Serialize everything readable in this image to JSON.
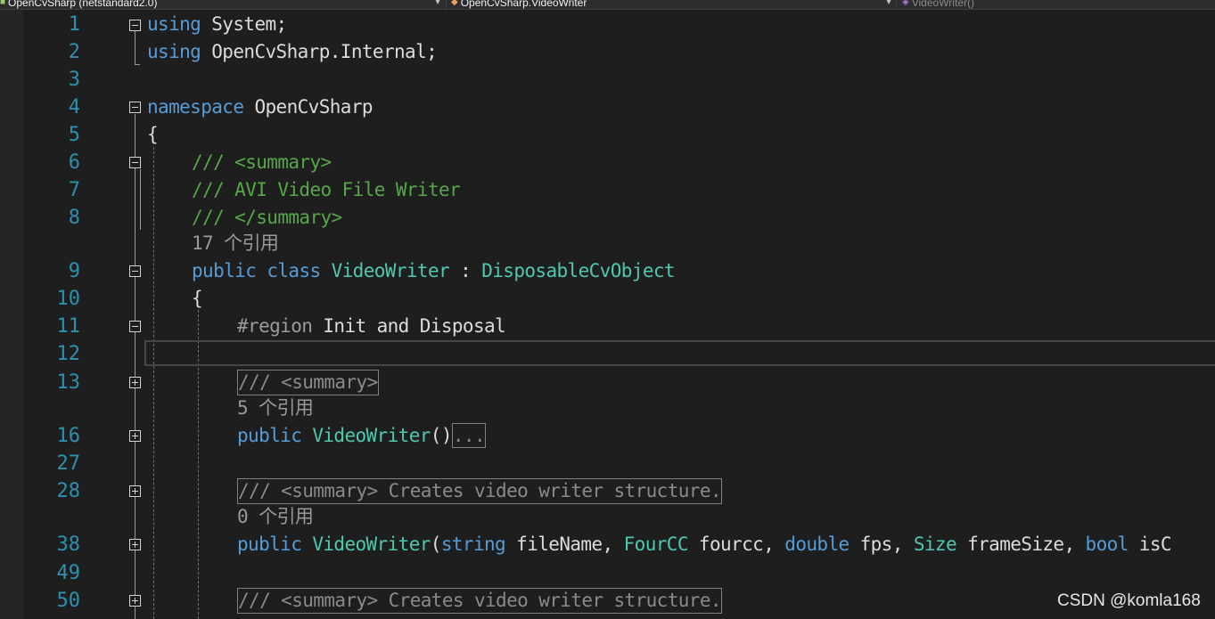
{
  "navbar": {
    "project": "OpenCvSharp (netstandard2.0)",
    "type": "OpenCvSharp.VideoWriter",
    "member": "VideoWriter()"
  },
  "lines": {
    "l1": {
      "num": "1",
      "using": "using",
      "name": "System",
      "semi": ";"
    },
    "l2": {
      "num": "2",
      "using": "using",
      "name": "OpenCvSharp.Internal",
      "semi": ";"
    },
    "l3": {
      "num": "3"
    },
    "l4": {
      "num": "4",
      "kw": "namespace",
      "name": "OpenCvSharp"
    },
    "l5": {
      "num": "5",
      "text": "{"
    },
    "l6": {
      "num": "6",
      "text": "/// <summary>"
    },
    "l7": {
      "num": "7",
      "text": "/// AVI Video File Writer"
    },
    "l8": {
      "num": "8",
      "text": "/// </summary>"
    },
    "lens1": "17 个引用",
    "l9": {
      "num": "9",
      "kw1": "public",
      "kw2": "class",
      "name": "VideoWriter",
      "colon": " : ",
      "base": "DisposableCvObject"
    },
    "l10": {
      "num": "10",
      "text": "{"
    },
    "l11": {
      "num": "11",
      "kw": "#region",
      "name": "Init and Disposal"
    },
    "l12": {
      "num": "12"
    },
    "l13": {
      "num": "13",
      "collapsed": "/// <summary>"
    },
    "lens2": "5 个引用",
    "l16": {
      "num": "16",
      "kw": "public",
      "name": "VideoWriter",
      "paren": "()",
      "collapsed": "..."
    },
    "l27": {
      "num": "27"
    },
    "l28": {
      "num": "28",
      "collapsed": "/// <summary> Creates video writer structure."
    },
    "lens3": "0 个引用",
    "l38": {
      "num": "38",
      "kw": "public",
      "name": "VideoWriter",
      "open": "(",
      "t1": "string",
      "p1": "fileName",
      "t2": "FourCC",
      "p2": "fourcc",
      "t3": "double",
      "p3": "fps",
      "t4": "Size",
      "p4": "frameSize",
      "t5": "bool",
      "p5": "isC",
      "comma": ", "
    },
    "l49": {
      "num": "49"
    },
    "l50": {
      "num": "50",
      "collapsed": "/// <summary> Creates video writer structure."
    }
  },
  "watermark": "CSDN @komla168"
}
